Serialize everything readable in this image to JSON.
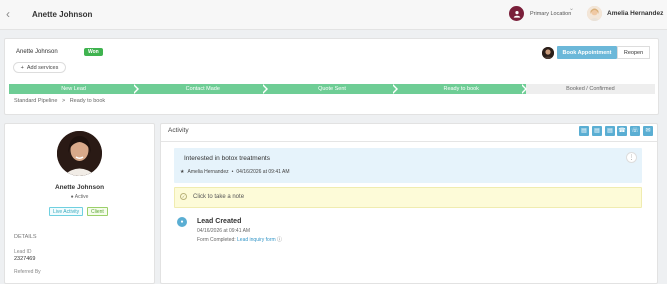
{
  "header": {
    "back_icon": "chevron-left-icon",
    "contact_name": "Anette Johnson",
    "location_label": "Primary Location",
    "user_name": "Amelia Hernandez"
  },
  "lead": {
    "name": "Anette Johnson",
    "status_badge": "Won",
    "add_services_label": "Add services",
    "book_appointment_label": "Book Appointment",
    "reopen_label": "Reopen"
  },
  "pipeline": {
    "stages": [
      "New Lead",
      "Contact Made",
      "Quote Sent",
      "Ready to book",
      "Booked / Confirmed"
    ],
    "breadcrumb": [
      "Standard Pipeline",
      ">",
      "Ready to book"
    ]
  },
  "profile": {
    "name": "Anette Johnson",
    "status": "Active",
    "tags": [
      "Live Activity",
      "Client"
    ],
    "details_heading": "DETAILS",
    "lead_id_label": "Lead ID",
    "lead_id_value": "2327469",
    "referred_by_label": "Referred By"
  },
  "activity": {
    "title": "Activity",
    "toolbar_icons": [
      "sms-icon",
      "print-icon",
      "note-icon",
      "call-icon",
      "phone-icon",
      "email-icon"
    ],
    "interest": {
      "title": "Interested in botox treatments",
      "author": "Amelia Hernandez",
      "timestamp": "04/16/2026 at 09:41 AM"
    },
    "note_placeholder": "Click to take a note",
    "timeline": {
      "title": "Lead Created",
      "timestamp": "04/16/2026 at 09:41 AM",
      "form_prefix": "Form Completed:",
      "form_link": "Lead inquiry form"
    }
  },
  "colors": {
    "pipeline_active": "#6ecd95",
    "accent_blue": "#6cb8d9",
    "won_green": "#3fb34f"
  }
}
